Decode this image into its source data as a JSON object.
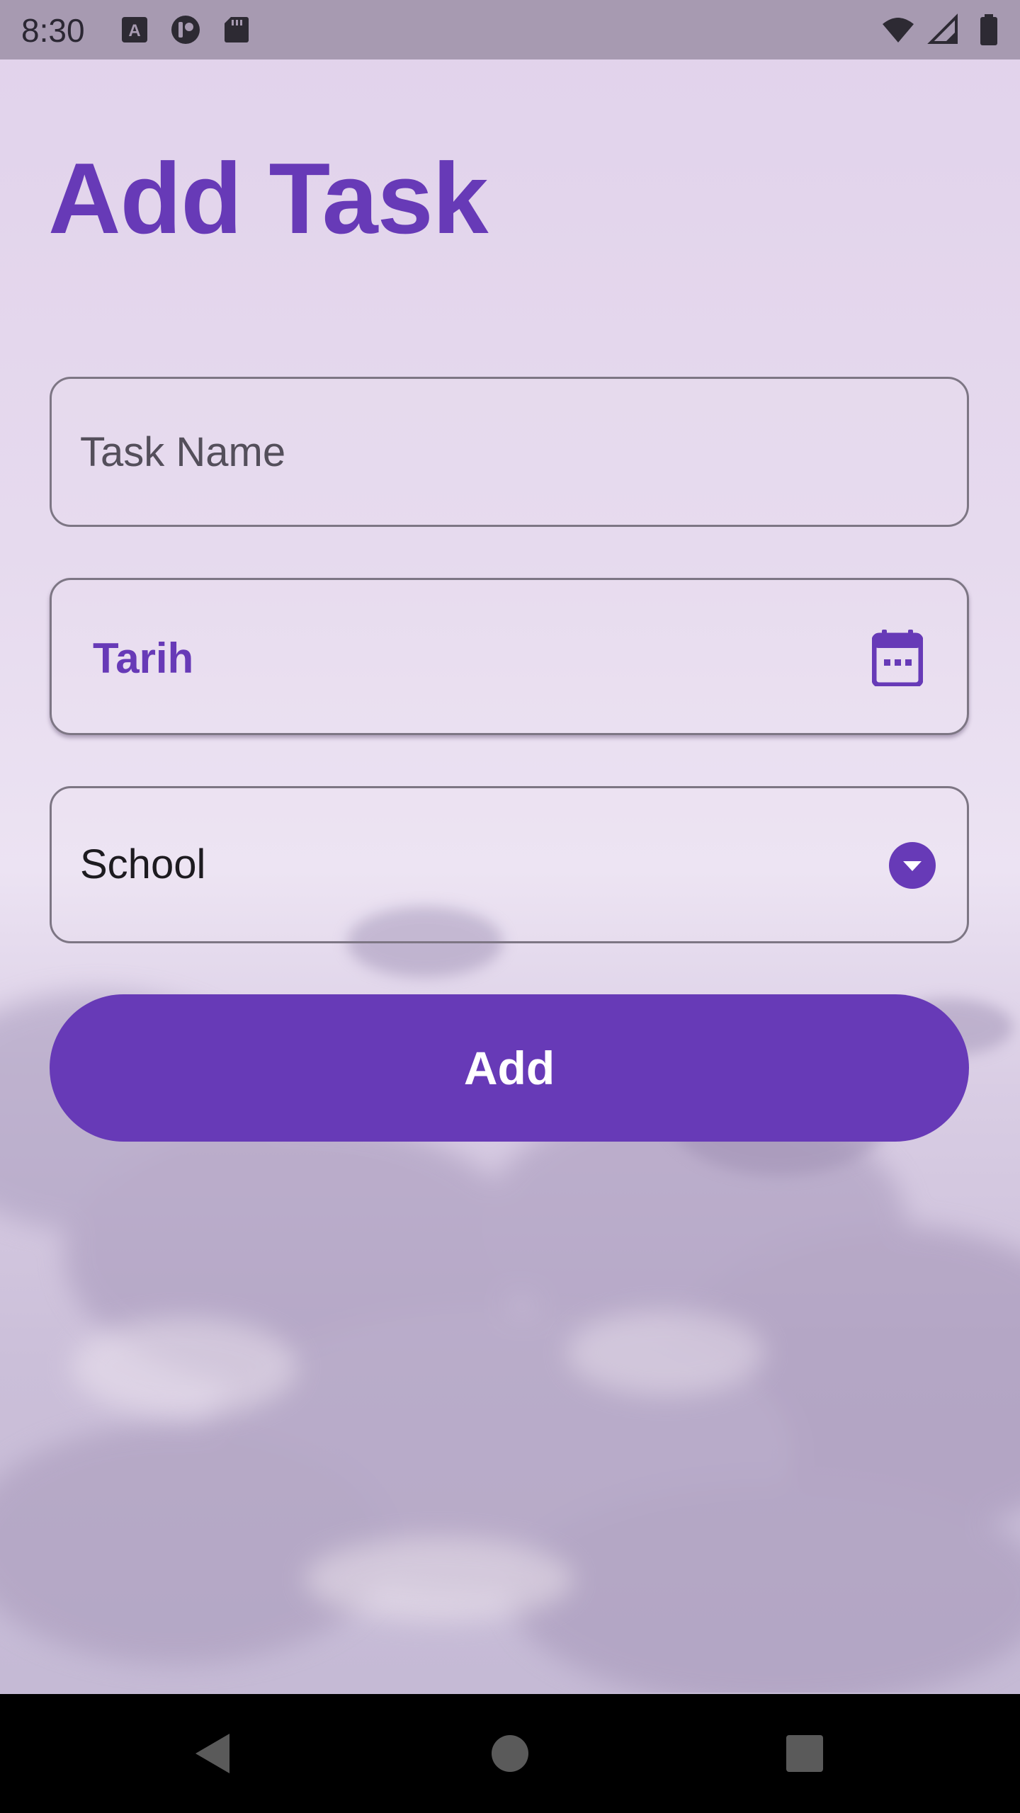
{
  "status_bar": {
    "time": "8:30",
    "left_icons": [
      "keyboard-a-icon",
      "app-circle-icon",
      "sd-card-icon"
    ],
    "right_icons": [
      "wifi-icon",
      "signal-icon",
      "battery-icon"
    ]
  },
  "page": {
    "title": "Add Task"
  },
  "form": {
    "task_name": {
      "placeholder": "Task Name",
      "value": ""
    },
    "date": {
      "label": "Tarih",
      "icon": "calendar-icon"
    },
    "category": {
      "selected": "School",
      "icon": "dropdown-circle-icon"
    },
    "submit_label": "Add"
  },
  "nav_bar": {
    "buttons": [
      "back",
      "home",
      "recents"
    ]
  },
  "colors": {
    "accent": "#673ab7",
    "status_bar": "#a79ab1",
    "nav_bar": "#000000",
    "field_border": "#7d7684"
  }
}
